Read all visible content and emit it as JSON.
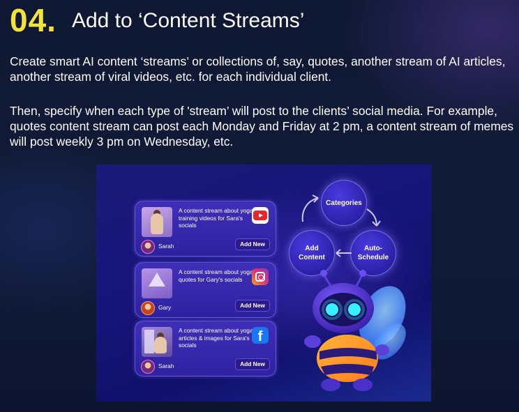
{
  "heading": {
    "number": "04.",
    "title": "Add to ‘Content Streams’"
  },
  "paragraphs": [
    "Create smart AI content ‘streams’ or collections of, say, quotes, another stream of AI articles, another stream of viral videos, etc. for each individual client.",
    "Then, specify when each type of 'stream’ will post to the clients’ social media. For example, quotes content stream can post each Monday and Friday at 2 pm, a content stream of memes will post weekly 3 pm on Wednesday, etc."
  ],
  "illustration": {
    "cards": [
      {
        "description": "A content stream about yoga training videos for Sara's socials",
        "user": "Sarah",
        "button": "Add New",
        "platform": "youtube-icon"
      },
      {
        "description": "A content stream about yoga quotes for Gary's socials",
        "user": "Gary",
        "button": "Add New",
        "platform": "instagram-icon"
      },
      {
        "description": "A content stream about yoga articles & images for Sara's socials",
        "user": "Sarah",
        "button": "Add New",
        "platform": "facebook-icon"
      }
    ],
    "cycle": {
      "top": "Categories",
      "right": "Auto-\nSchedule",
      "left": "Add\nContent"
    },
    "facebook_glyph": "f"
  },
  "colors": {
    "accent_number": "#f2e23a",
    "background": "#111b38"
  }
}
